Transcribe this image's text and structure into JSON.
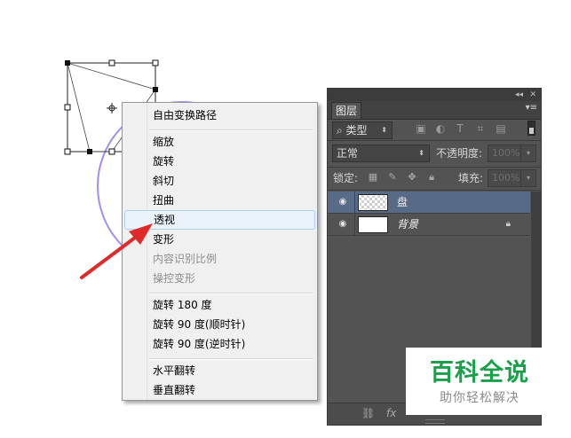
{
  "context_menu": {
    "items": [
      {
        "label": "自由变换路径"
      },
      {
        "label": "缩放"
      },
      {
        "label": "旋转"
      },
      {
        "label": "斜切"
      },
      {
        "label": "扭曲"
      },
      {
        "label": "透视",
        "state": "hover"
      },
      {
        "label": "变形"
      },
      {
        "label": "内容识别比例",
        "state": "disabled"
      },
      {
        "label": "操控变形",
        "state": "disabled"
      },
      {
        "label": "旋转 180 度"
      },
      {
        "label": "旋转 90 度(顺时针)"
      },
      {
        "label": "旋转 90 度(逆时针)"
      },
      {
        "label": "水平翻转"
      },
      {
        "label": "垂直翻转"
      }
    ]
  },
  "layers_panel": {
    "collapse_glyph": "◂◂",
    "close_glyph": "✕",
    "tab_label": "图层",
    "menu_glyph": "▾≡",
    "filter": {
      "label": "类型",
      "icons": [
        "image-filter-icon",
        "adjustment-filter-icon",
        "text-filter-icon",
        "shape-filter-icon",
        "smart-object-filter-icon"
      ]
    },
    "blend_mode": "正常",
    "opacity_label": "不透明度:",
    "opacity_value": "100%",
    "lock_label": "锁定:",
    "fill_label": "填充:",
    "fill_value": "100%",
    "layers": [
      {
        "name": "盘",
        "selected": true,
        "thumb": "transparent"
      },
      {
        "name": "背景",
        "selected": false,
        "thumb": "white",
        "locked": true
      }
    ],
    "bottom_icons": [
      "link-icon",
      "fx-icon"
    ]
  },
  "watermark": {
    "title": "百科全说",
    "subtitle": "助你轻松解决"
  },
  "colors": {
    "menu_hover_bg": "#eaf2fb",
    "selected_layer": "#576a87",
    "arrow": "#e02a2a",
    "circle_stroke": "#a58cf0",
    "watermark_green": "#1aa04a"
  }
}
